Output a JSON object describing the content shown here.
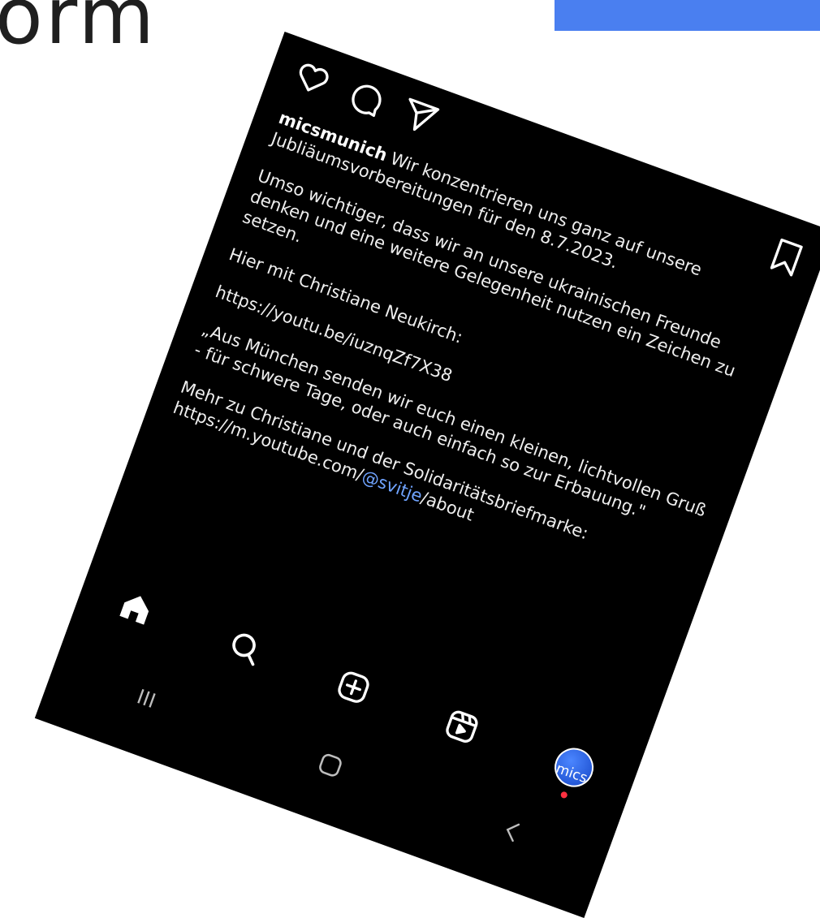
{
  "background": {
    "partial_text": "orm",
    "accent_color": "#4a7ff0"
  },
  "post": {
    "actions": {
      "like_icon": "heart-icon",
      "comment_icon": "comment-icon",
      "share_icon": "send-icon",
      "save_icon": "bookmark-icon"
    },
    "username": "micsmunich",
    "caption_first": "Wir konzentrieren uns ganz auf unsere Jubliäumsvorbereitungen für den 8.7.2023.",
    "paragraph_2": "Umso wichtiger, dass wir an unsere ukrainischen Freunde denken und eine weitere Gelegenheit nutzen ein Zeichen zu setzen.",
    "paragraph_3": "Hier mit Christiane Neukirch:",
    "link_1": "https://youtu.be/iuznqZf7X38",
    "quote": "„Aus München senden wir euch einen kleinen, lichtvollen Gruß - für schwere Tage, oder auch einfach so zur Erbauung.\"",
    "more_intro": "Mehr zu Christiane und der Solidaritätsbriefmarke:",
    "link_2_prefix": "https://m.youtube.com/",
    "link_2_mention": "@svitje",
    "link_2_suffix": "/about"
  },
  "nav": {
    "home_icon": "home-icon",
    "search_icon": "search-icon",
    "create_icon": "plus-square-icon",
    "reels_icon": "reels-icon",
    "avatar_label": "mics"
  },
  "system_nav": {
    "recents_icon": "recents-icon",
    "home_icon": "system-home-icon",
    "back_icon": "back-icon"
  },
  "colors": {
    "screen_bg": "#000000",
    "text": "#f5f5f5",
    "mention": "#6fa3ff",
    "avatar": "#2f6bff",
    "notification_dot": "#ff3040"
  }
}
